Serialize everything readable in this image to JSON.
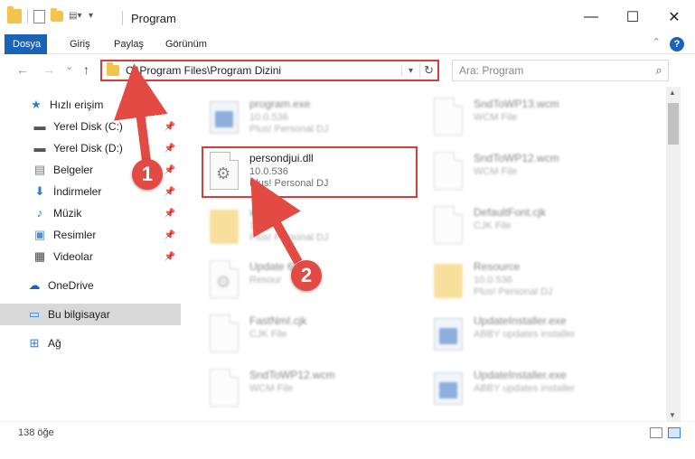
{
  "window": {
    "title": "Program",
    "minimize": "—",
    "maximize": "☐",
    "close": "✕"
  },
  "ribbon": {
    "tabs": [
      "Dosya",
      "Giriş",
      "Paylaş",
      "Görünüm"
    ],
    "help": "?"
  },
  "nav": {
    "back": "←",
    "forward": "→",
    "recent": "⌄",
    "up": "↑",
    "address": "C:\\Program Files\\Program Dizini",
    "search_placeholder": "Ara: Program"
  },
  "sidebar": {
    "items": [
      {
        "label": "Hızlı erişim",
        "icon": "star-icon"
      },
      {
        "label": "Yerel Disk (C:)",
        "icon": "drive-icon"
      },
      {
        "label": "Yerel Disk (D:)",
        "icon": "drive-icon"
      },
      {
        "label": "Belgeler",
        "icon": "documents-icon"
      },
      {
        "label": "İndirmeler",
        "icon": "download-icon"
      },
      {
        "label": "Müzik",
        "icon": "music-icon"
      },
      {
        "label": "Resimler",
        "icon": "pictures-icon"
      },
      {
        "label": "Videolar",
        "icon": "video-icon"
      },
      {
        "label": "OneDrive",
        "icon": "cloud-icon"
      },
      {
        "label": "Bu bilgisayar",
        "icon": "computer-icon"
      },
      {
        "label": "Ağ",
        "icon": "network-icon"
      }
    ]
  },
  "files": [
    {
      "name": "program.exe",
      "line2": "10.0.536",
      "line3": "Plus! Personal DJ"
    },
    {
      "name": "SndToWP13.wcm",
      "line2": "WCM File",
      "line3": ""
    },
    {
      "name": "persondjui.dll",
      "line2": "10.0.536",
      "line3": "Plus! Personal DJ"
    },
    {
      "name": "SndToWP12.wcm",
      "line2": "WCM File",
      "line3": ""
    },
    {
      "name": "xe",
      "line2": "10.0",
      "line3": "Plus! Personal DJ"
    },
    {
      "name": "DefaultFont.cjk",
      "line2": "CJK File",
      "line3": ""
    },
    {
      "name": "Update 65.dll",
      "line2": "Resour",
      "line3": ""
    },
    {
      "name": "Resource",
      "line2": "10.0.536",
      "line3": "Plus! Personal DJ"
    },
    {
      "name": "FastNmI.cjk",
      "line2": "CJK File",
      "line3": ""
    },
    {
      "name": "UpdateInstaller.exe",
      "line2": "ABBY updates installer",
      "line3": ""
    },
    {
      "name": "SndToWP12.wcm",
      "line2": "WCM File",
      "line3": ""
    },
    {
      "name": "UpdateInstaller.exe",
      "line2": "ABBY updates installer",
      "line3": ""
    }
  ],
  "status": {
    "count": "138 öğe"
  },
  "callouts": [
    "1",
    "2"
  ],
  "colors": {
    "accent": "#1a63b7",
    "highlight": "#d93a3a",
    "callout": "#e24a43"
  }
}
